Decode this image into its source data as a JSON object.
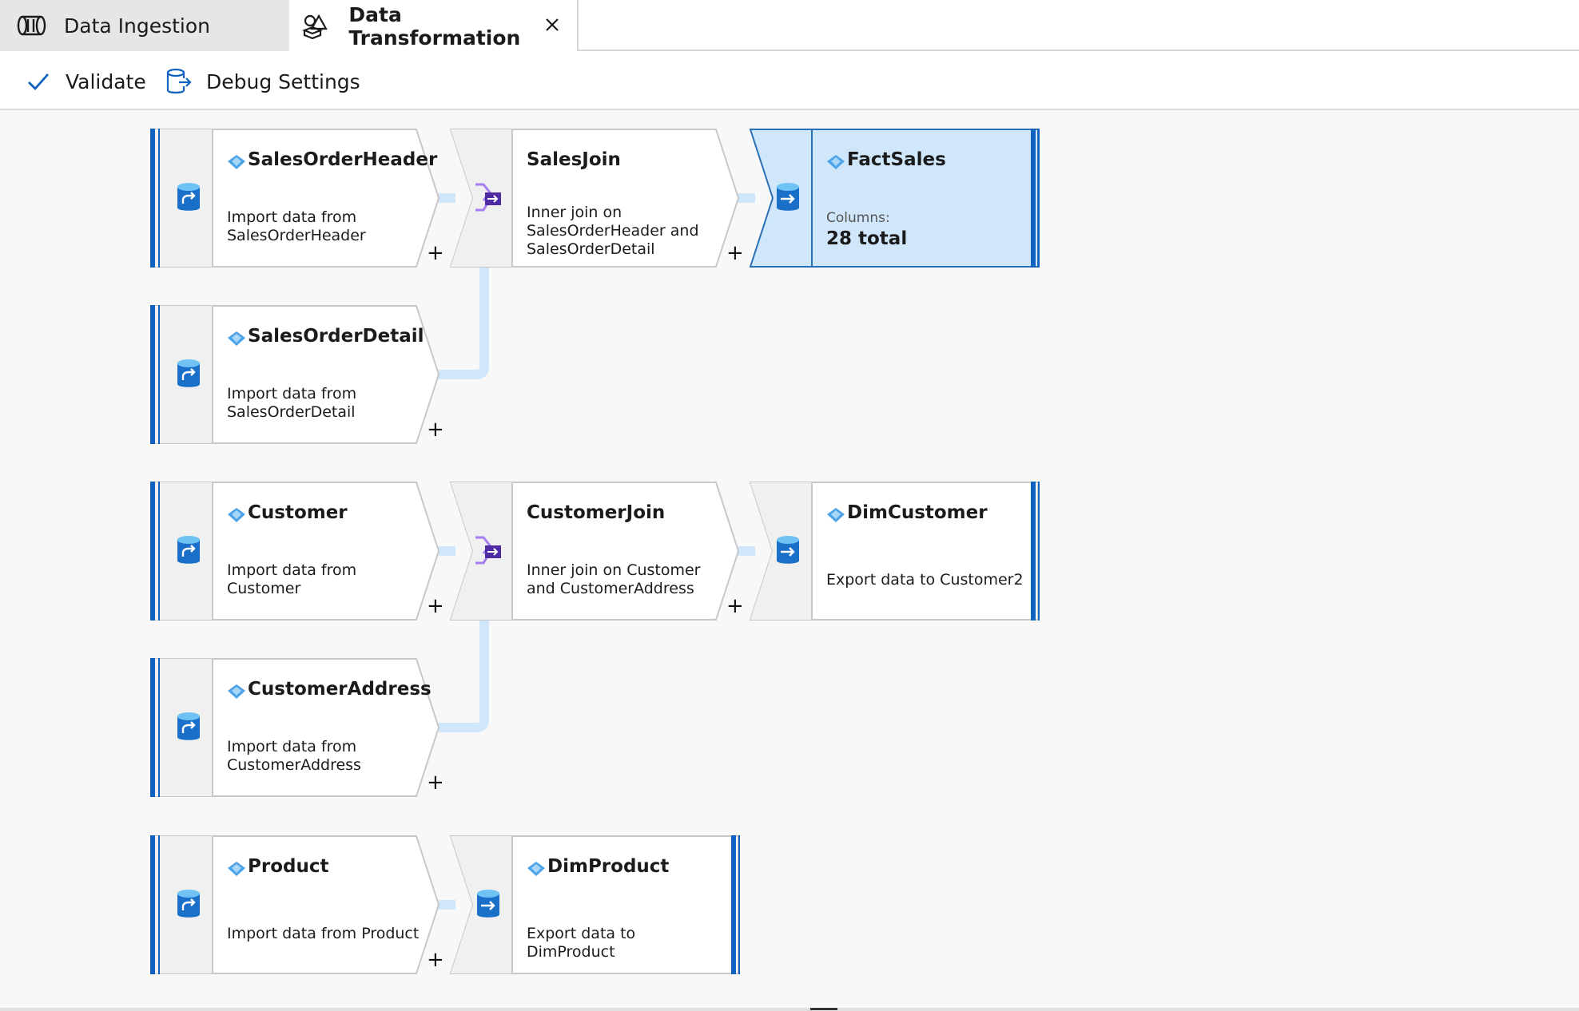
{
  "tabs": [
    {
      "label": "Data Ingestion",
      "icon": "data-ingestion-icon"
    },
    {
      "label": "Data Transformation",
      "icon": "data-transformation-icon",
      "active": true
    }
  ],
  "toolbar": {
    "validate_label": "Validate",
    "debug_label": "Debug Settings"
  },
  "colors": {
    "accent": "#0f62c0",
    "connector": "#cfe6fb",
    "selected_fill": "#cfe6fb",
    "join_icon": "#8a5bd6"
  },
  "nodes": {
    "sales_order_header": {
      "title": "SalesOrderHeader",
      "desc": "Import data from SalesOrderHeader",
      "type": "source"
    },
    "sales_join": {
      "title": "SalesJoin",
      "desc": "Inner join on SalesOrderHeader and SalesOrderDetail",
      "type": "join"
    },
    "fact_sales": {
      "title": "FactSales",
      "columns_label": "Columns:",
      "columns_value": "28 total",
      "type": "sink",
      "selected": true
    },
    "sales_order_detail": {
      "title": "SalesOrderDetail",
      "desc": "Import data from SalesOrderDetail",
      "type": "source"
    },
    "customer": {
      "title": "Customer",
      "desc": "Import data from Customer",
      "type": "source"
    },
    "customer_join": {
      "title": "CustomerJoin",
      "desc": "Inner join on Customer and CustomerAddress",
      "type": "join"
    },
    "dim_customer": {
      "title": "DimCustomer",
      "desc": "Export data to Customer2",
      "type": "sink"
    },
    "customer_address": {
      "title": "CustomerAddress",
      "desc": "Import data from CustomerAddress",
      "type": "source"
    },
    "product": {
      "title": "Product",
      "desc": "Import data from Product",
      "type": "source"
    },
    "dim_product": {
      "title": "DimProduct",
      "desc": "Export data to DimProduct",
      "type": "sink"
    }
  },
  "add_symbol": "+"
}
